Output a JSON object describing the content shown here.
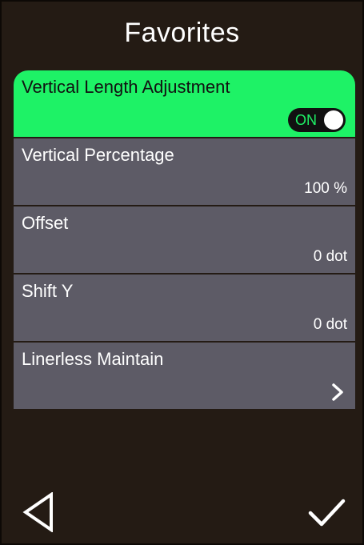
{
  "header": {
    "title": "Favorites"
  },
  "items": [
    {
      "label": "Vertical Length Adjustment",
      "toggle_text": "ON",
      "toggle_on": true,
      "selected": true
    },
    {
      "label": "Vertical Percentage",
      "value": "100 %"
    },
    {
      "label": "Offset",
      "value": "0 dot"
    },
    {
      "label": "Shift Y",
      "value": "0 dot"
    },
    {
      "label": "Linerless Maintain",
      "icon": "chevron-right-icon"
    }
  ],
  "footer": {
    "back_icon": "back-triangle-icon",
    "confirm_icon": "checkmark-icon"
  },
  "colors": {
    "background": "#241b14",
    "item_background": "#5d5b66",
    "selected_background": "#1ef266",
    "toggle_text": "#1ef266"
  }
}
